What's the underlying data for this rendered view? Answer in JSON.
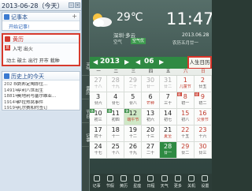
{
  "left": {
    "date_title": "2013-06-28（今天）",
    "memo": {
      "title": "记事本",
      "plus": "+",
      "link": "开始记事!"
    },
    "almanac": {
      "title": "黄历",
      "yi_badge": "宜",
      "yi_text": "入宅 出火",
      "ji_text": "动土 破土 出行 开市 栽种"
    },
    "history": {
      "title": "历史上的今天",
      "rows": [
        {
          "year": "202 BC",
          "text": "刘邦定陶即位..."
        },
        {
          "year": "1491年",
          "text": "亨利八世出生"
        },
        {
          "year": "1881年",
          "text": "奥地利与塞尔维亚..."
        },
        {
          "year": "1914年",
          "text": "萨拉热窝事件"
        },
        {
          "year": "1919年",
          "text": "凡尔赛和约签订"
        },
        {
          "year": "1971年",
          "text": "法国哲学家..."
        }
      ]
    }
  },
  "right": {
    "side_tabs": [
      "天气",
      "黄历",
      "节日",
      "记事"
    ],
    "weather": {
      "temp": "29℃",
      "location": "深圳·多云",
      "air_label": "空气",
      "air_badge": "空气优"
    },
    "clock": {
      "time": "11:47",
      "date": "2013.06.28",
      "lunar": "农历五月廿一"
    },
    "calendar": {
      "year": "2013",
      "month": "06",
      "prev": "◀",
      "next": "▶",
      "life_calendar": "人生日历",
      "weekdays": [
        "一",
        "二",
        "三",
        "四",
        "五",
        "六",
        "日"
      ],
      "weeks": [
        [
          {
            "d": "27",
            "l": "十八",
            "out": true
          },
          {
            "d": "28",
            "l": "十九",
            "out": true
          },
          {
            "d": "29",
            "l": "二十",
            "out": true
          },
          {
            "d": "30",
            "l": "廿一",
            "out": true
          },
          {
            "d": "31",
            "l": "廿二",
            "out": true
          },
          {
            "d": "1",
            "l": "儿童节",
            "fest": true
          },
          {
            "d": "2",
            "l": "廿五"
          }
        ],
        [
          {
            "d": "3",
            "l": "廿六"
          },
          {
            "d": "4",
            "l": "廿七"
          },
          {
            "d": "5",
            "l": "廿八"
          },
          {
            "d": "6",
            "l": "芒种",
            "fest": true
          },
          {
            "d": "7",
            "l": "三十"
          },
          {
            "d": "8",
            "l": "初一",
            "tag": "班",
            "work": true
          },
          {
            "d": "9",
            "l": "初二",
            "tag": "班",
            "work": true
          }
        ],
        [
          {
            "d": "10",
            "l": "初三",
            "tag": "休"
          },
          {
            "d": "11",
            "l": "初四",
            "tag": "休"
          },
          {
            "d": "12",
            "l": "端午节",
            "fest": true,
            "hl": true,
            "tag": "休"
          },
          {
            "d": "13",
            "l": "初六"
          },
          {
            "d": "14",
            "l": "初七"
          },
          {
            "d": "15",
            "l": "初八"
          },
          {
            "d": "16",
            "l": "父亲节",
            "fest": true
          }
        ],
        [
          {
            "d": "17",
            "l": "初十"
          },
          {
            "d": "18",
            "l": "十一"
          },
          {
            "d": "19",
            "l": "十二"
          },
          {
            "d": "20",
            "l": "十三"
          },
          {
            "d": "21",
            "l": "夏至",
            "fest": true
          },
          {
            "d": "22",
            "l": "十五"
          },
          {
            "d": "23",
            "l": "十六"
          }
        ],
        [
          {
            "d": "24",
            "l": "十七"
          },
          {
            "d": "25",
            "l": "十八"
          },
          {
            "d": "26",
            "l": "十九"
          },
          {
            "d": "27",
            "l": "二十"
          },
          {
            "d": "28",
            "l": "廿一",
            "today": true
          },
          {
            "d": "29",
            "l": "廿二"
          },
          {
            "d": "30",
            "l": "廿三"
          }
        ]
      ]
    },
    "toolbar": [
      "记事",
      "节假",
      "黄历",
      "星座",
      "日程",
      "天气",
      "更多",
      "关机",
      "设置"
    ]
  }
}
